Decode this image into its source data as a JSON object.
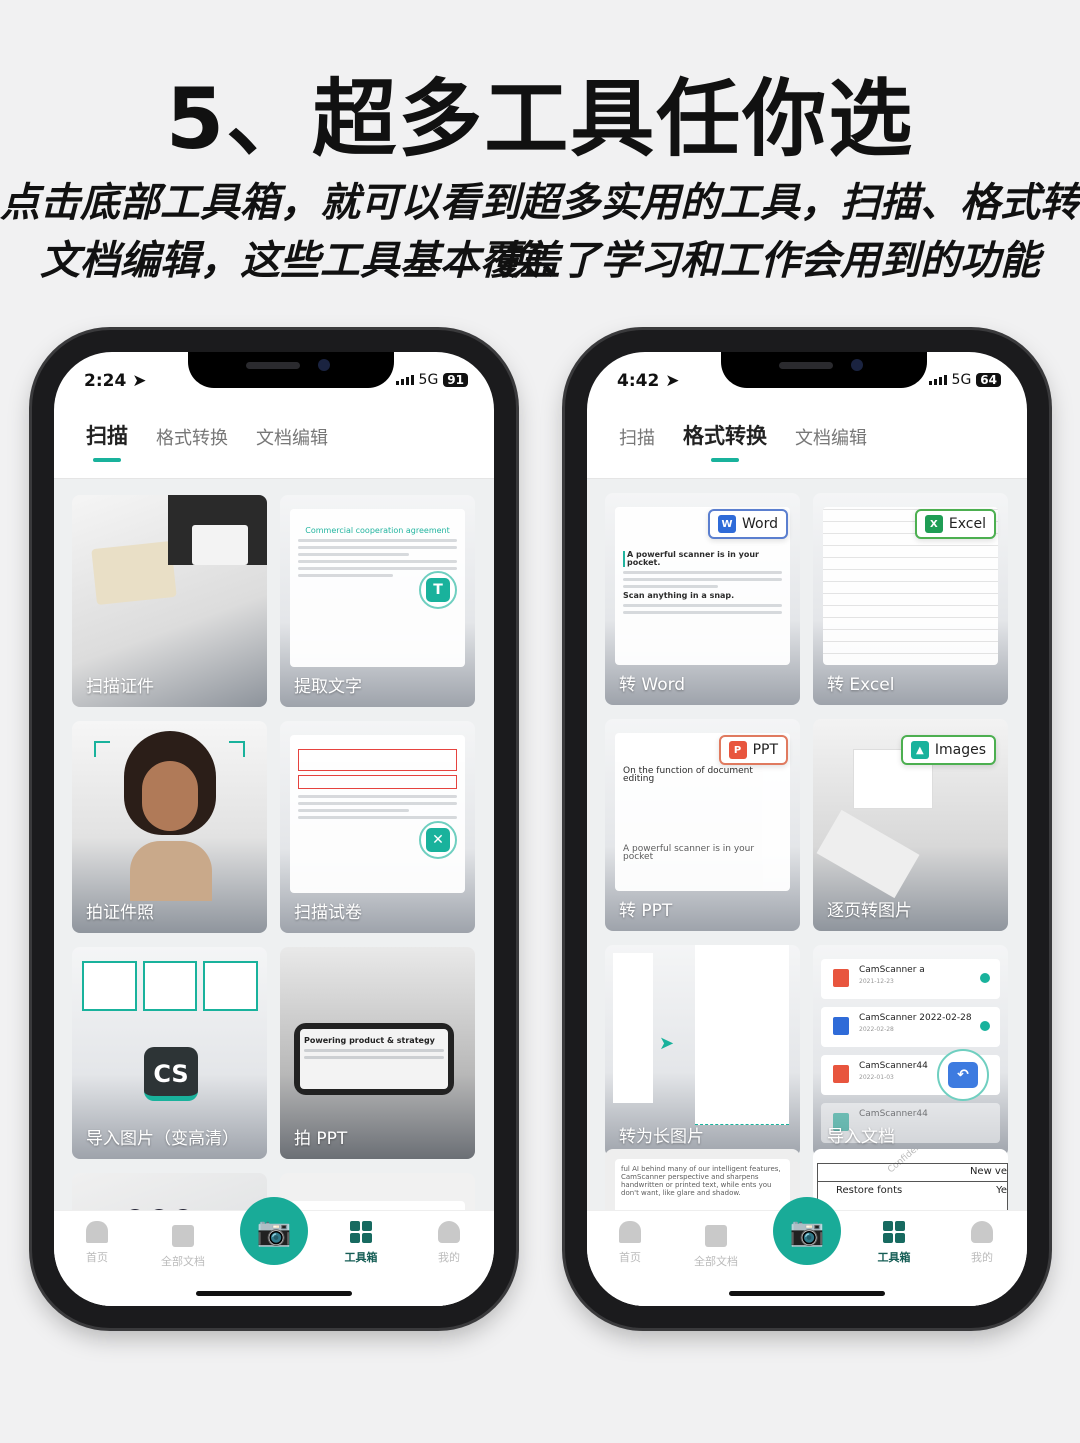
{
  "headline": "5、超多工具任你选",
  "subtitle_lines": [
    "点击底部工具箱，就可以看到超多实用的工具，扫描、格式转换、",
    "文档编辑，这些工具基本覆盖了学习和工作会用到的功能"
  ],
  "accent_color": "#19b29c",
  "phones": [
    {
      "status": {
        "time": "2:24",
        "network": "5G",
        "battery": "91"
      },
      "tabs": [
        "扫描",
        "格式转换",
        "文档编辑"
      ],
      "active_tab": 0,
      "cards": [
        {
          "label": "扫描证件"
        },
        {
          "label": "提取文字",
          "doc_title": "Commercial cooperation agreement"
        },
        {
          "label": "拍证件照"
        },
        {
          "label": "扫描试卷"
        },
        {
          "label": "导入图片（变高清）",
          "badge": "CS"
        },
        {
          "label": "拍 PPT",
          "doc_title": "Powering product & strategy"
        },
        {
          "label": "",
          "badge_numbers": [
            "1",
            "2",
            "3"
          ]
        },
        {
          "label": ""
        }
      ],
      "nav": [
        "首页",
        "全部文档",
        "工具箱",
        "我的"
      ],
      "active_nav": 2
    },
    {
      "status": {
        "time": "4:42",
        "network": "5G",
        "battery": "64"
      },
      "tabs": [
        "扫描",
        "格式转换",
        "文档编辑"
      ],
      "active_tab": 1,
      "cards": [
        {
          "label": "转 Word",
          "chip": "Word",
          "doc_title": "A powerful scanner is in your pocket.",
          "doc_sub": "Scan anything in a snap."
        },
        {
          "label": "转 Excel",
          "chip": "Excel"
        },
        {
          "label": "转 PPT",
          "chip": "PPT",
          "doc_title": "On the function of document editing",
          "doc_sub": "A powerful scanner is in your pocket"
        },
        {
          "label": "逐页转图片",
          "chip": "Images"
        },
        {
          "label": "转为长图片"
        },
        {
          "label": "导入文档",
          "files": [
            {
              "name": "CamScanner a",
              "date": "2021-12-23"
            },
            {
              "name": "CamScanner 2022-02-28",
              "date": "2022-02-28"
            },
            {
              "name": "CamScanner44",
              "date": "2022-01-03"
            },
            {
              "name": "CamScanner44",
              "date": ""
            }
          ]
        },
        {
          "label": "",
          "doc_text": "ful AI behind many of our intelligent features, CamScanner perspective and sharpens handwritten or printed text, while ents you don't want, like glare and shadow."
        },
        {
          "label": "",
          "table": [
            "New ve",
            "Restore fonts",
            "Ye"
          ],
          "watermark": "Confidential"
        }
      ],
      "nav": [
        "首页",
        "全部文档",
        "工具箱",
        "我的"
      ],
      "active_nav": 2
    }
  ]
}
